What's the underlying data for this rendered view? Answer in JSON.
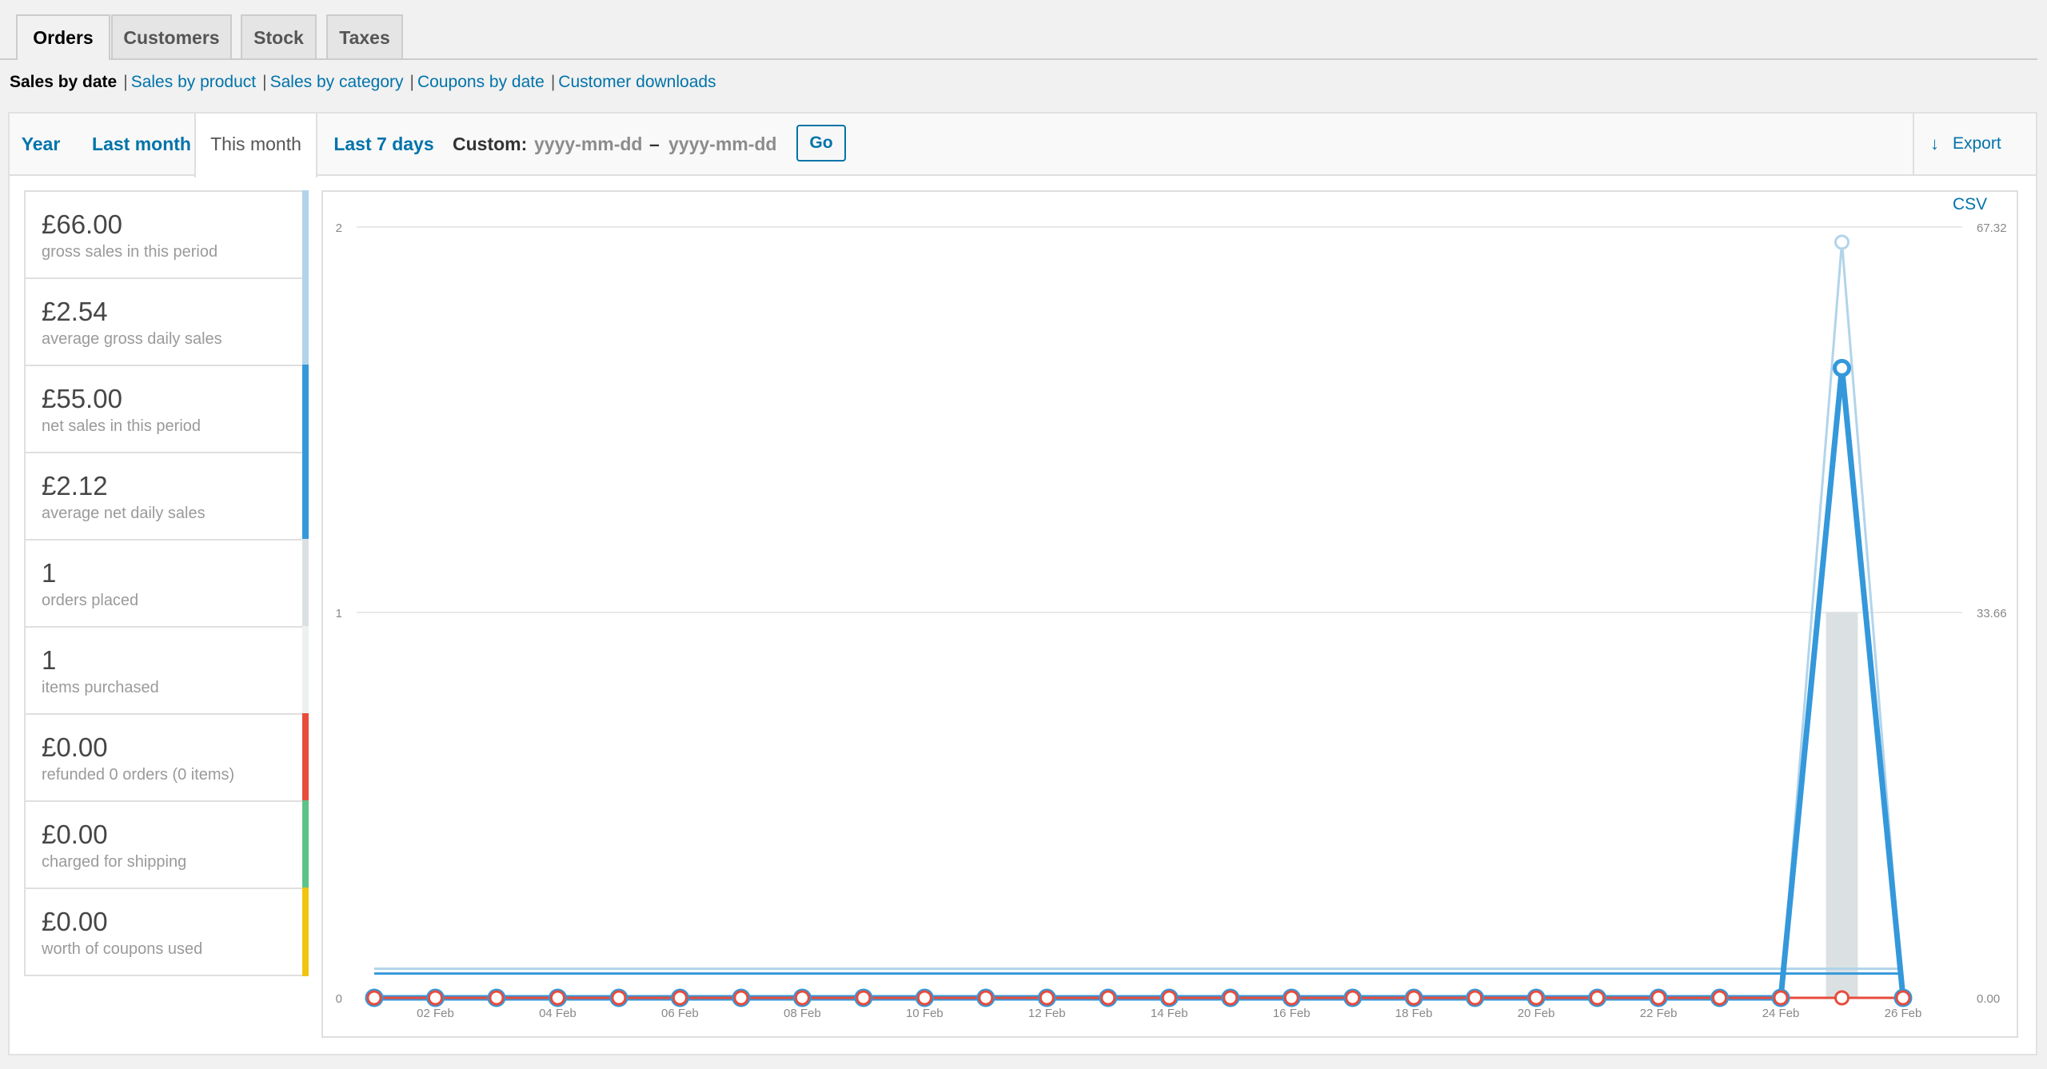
{
  "tabs": [
    "Orders",
    "Customers",
    "Stock",
    "Taxes"
  ],
  "report_links": {
    "current": "Sales by date",
    "links": [
      "Sales by product",
      "Sales by category",
      "Coupons by date",
      "Customer downloads"
    ]
  },
  "range": {
    "tabs": [
      "Year",
      "Last month",
      "This month",
      "Last 7 days"
    ],
    "active": "This month",
    "custom_label": "Custom:",
    "start_placeholder": "yyyy-mm-dd",
    "separator": "–",
    "end_placeholder": "yyyy-mm-dd",
    "go_label": "Go",
    "export_label": "Export CSV"
  },
  "legend": [
    {
      "amount": "£66.00",
      "desc": "gross sales in this period",
      "color": "#b1d4ea"
    },
    {
      "amount": "£2.54",
      "desc": "average gross daily sales",
      "color": "#b1d4ea"
    },
    {
      "amount": "£55.00",
      "desc": "net sales in this period",
      "color": "#3498db"
    },
    {
      "amount": "£2.12",
      "desc": "average net daily sales",
      "color": "#3498db"
    },
    {
      "amount": "1",
      "desc": "orders placed",
      "color": "#dbe1e3"
    },
    {
      "amount": "1",
      "desc": "items purchased",
      "color": "#ecf0f1"
    },
    {
      "amount": "£0.00",
      "desc": "refunded 0 orders (0 items)",
      "color": "#e74c3c"
    },
    {
      "amount": "£0.00",
      "desc": "charged for shipping",
      "color": "#5cc488"
    },
    {
      "amount": "£0.00",
      "desc": "worth of coupons used",
      "color": "#f1c40f"
    }
  ],
  "chart_data": {
    "type": "line",
    "x": [
      "01 Feb",
      "02 Feb",
      "03 Feb",
      "04 Feb",
      "05 Feb",
      "06 Feb",
      "07 Feb",
      "08 Feb",
      "09 Feb",
      "10 Feb",
      "11 Feb",
      "12 Feb",
      "13 Feb",
      "14 Feb",
      "15 Feb",
      "16 Feb",
      "17 Feb",
      "18 Feb",
      "19 Feb",
      "20 Feb",
      "21 Feb",
      "22 Feb",
      "23 Feb",
      "24 Feb",
      "25 Feb",
      "26 Feb"
    ],
    "x_tick_labels": [
      "02 Feb",
      "04 Feb",
      "06 Feb",
      "08 Feb",
      "10 Feb",
      "12 Feb",
      "14 Feb",
      "16 Feb",
      "18 Feb",
      "20 Feb",
      "22 Feb",
      "24 Feb",
      "26 Feb"
    ],
    "left_ticks": [
      "0",
      "1",
      "2"
    ],
    "right_ticks": [
      "0.00",
      "33.66",
      "67.32"
    ],
    "ylim_left": [
      0,
      2
    ],
    "ylim_right": [
      0,
      67.32
    ],
    "grid": true,
    "bars": {
      "name": "orders placed",
      "values": [
        0,
        0,
        0,
        0,
        0,
        0,
        0,
        0,
        0,
        0,
        0,
        0,
        0,
        0,
        0,
        0,
        0,
        0,
        0,
        0,
        0,
        0,
        0,
        0,
        1,
        0
      ],
      "color": "#dbe1e3",
      "axis": "left"
    },
    "series": [
      {
        "name": "gross sales",
        "values": [
          0,
          0,
          0,
          0,
          0,
          0,
          0,
          0,
          0,
          0,
          0,
          0,
          0,
          0,
          0,
          0,
          0,
          0,
          0,
          0,
          0,
          0,
          0,
          0,
          66,
          0
        ],
        "color": "#b1d4ea",
        "axis": "right"
      },
      {
        "name": "net sales",
        "values": [
          0,
          0,
          0,
          0,
          0,
          0,
          0,
          0,
          0,
          0,
          0,
          0,
          0,
          0,
          0,
          0,
          0,
          0,
          0,
          0,
          0,
          0,
          0,
          0,
          55,
          0
        ],
        "color": "#3498db",
        "axis": "right"
      },
      {
        "name": "refunds",
        "values": [
          0,
          0,
          0,
          0,
          0,
          0,
          0,
          0,
          0,
          0,
          0,
          0,
          0,
          0,
          0,
          0,
          0,
          0,
          0,
          0,
          0,
          0,
          0,
          0,
          0,
          0
        ],
        "color": "#e74c3c",
        "axis": "right"
      }
    ],
    "average_lines": [
      {
        "name": "average gross daily sales",
        "value": 2.54,
        "color": "#b1d4ea",
        "axis": "right"
      },
      {
        "name": "average net daily sales",
        "value": 2.12,
        "color": "#3498db",
        "axis": "right"
      }
    ]
  }
}
